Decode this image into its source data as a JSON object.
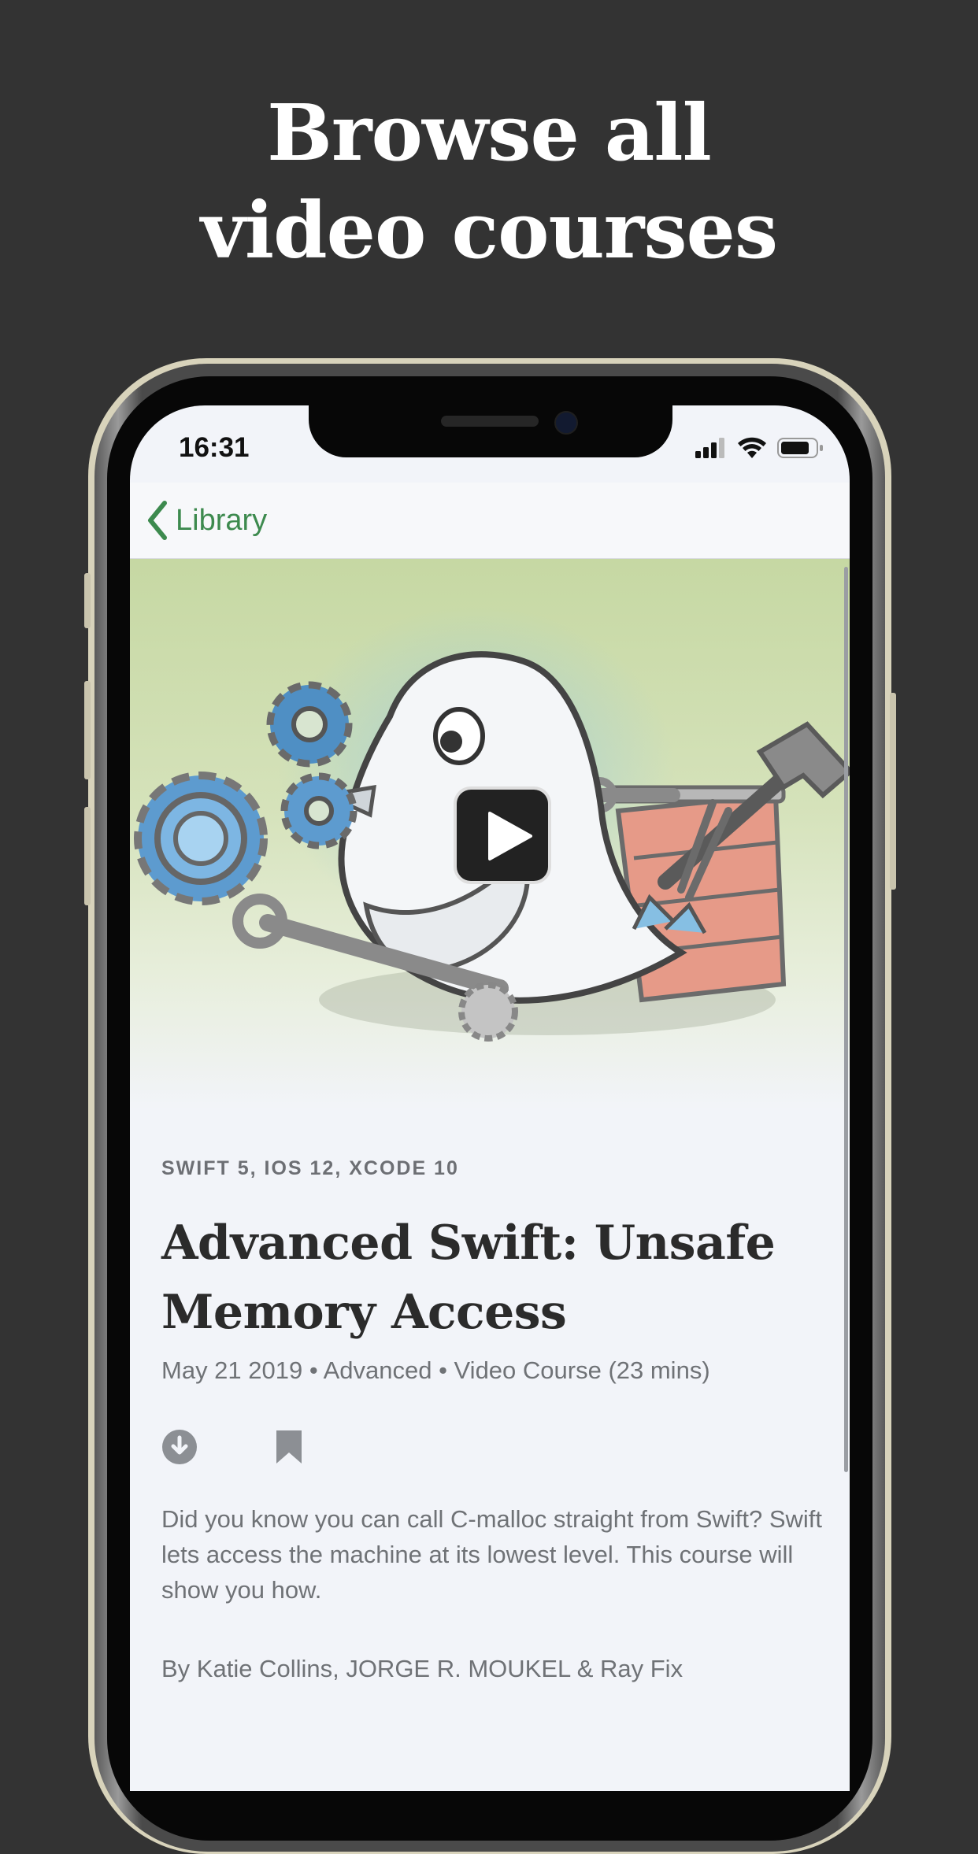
{
  "headline": {
    "line1": "Browse all",
    "line2": "video courses"
  },
  "status_bar": {
    "time": "16:31",
    "icons": [
      "signal-icon",
      "wifi-icon",
      "battery-icon"
    ]
  },
  "navbar": {
    "back_label": "Library",
    "back_icon": "chevron-left-icon"
  },
  "hero": {
    "play_icon": "play-icon"
  },
  "course": {
    "tags": "SWIFT 5, IOS 12, XCODE 10",
    "title": "Advanced Swift: Unsafe Memory Access",
    "meta": "May 21 2019 • Advanced • Video Course (23 mins)",
    "description": "Did you know you can call C-malloc straight from Swift? Swift lets access the machine at its lowest level. This course will show you how.",
    "authors": "By Katie Collins, JORGE R. MOUKEL & Ray Fix"
  },
  "actions": {
    "download_icon": "download-icon",
    "bookmark_icon": "bookmark-icon"
  },
  "colors": {
    "background": "#333333",
    "accent": "#3d8a4e",
    "screen": "#f2f4f9",
    "text": "#2b2b2b",
    "muted": "#6f7276"
  }
}
